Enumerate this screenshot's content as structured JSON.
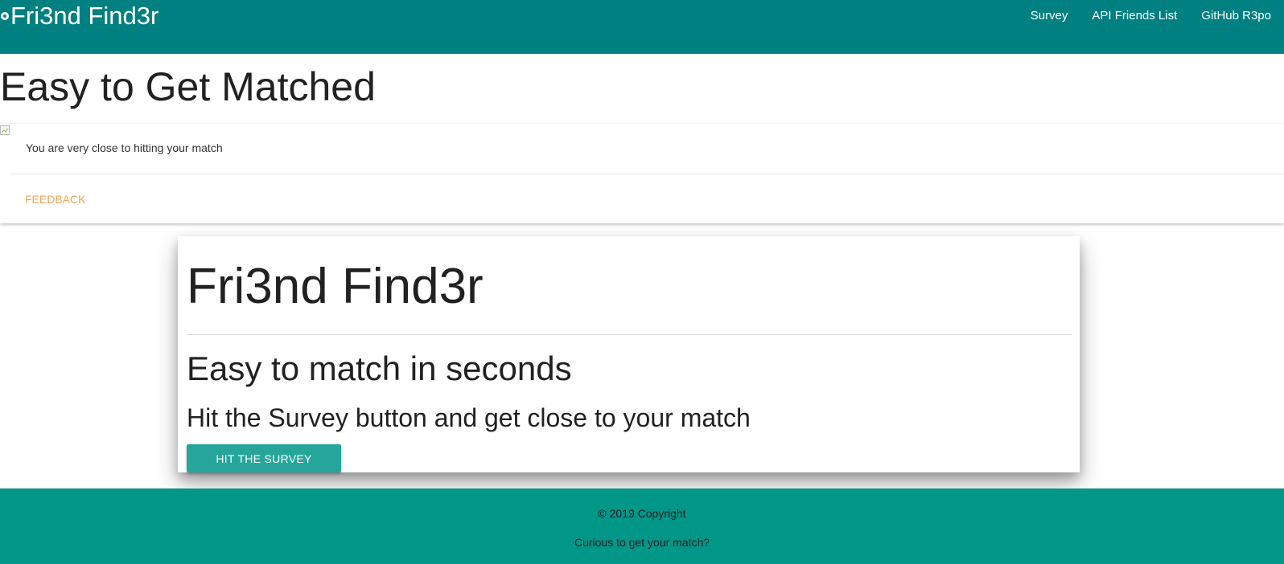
{
  "navbar": {
    "brand": "Fri3nd Find3r",
    "brand_icon": "logo-icon",
    "links": [
      "Survey",
      "API Friends List",
      "GitHub R3po"
    ]
  },
  "hero": {
    "title": "Easy to Get Matched"
  },
  "card": {
    "image_icon": "broken-image-icon",
    "text": "You are very close to hitting your match",
    "action": "FEEDBACK"
  },
  "jumbotron": {
    "title": "Fri3nd Find3r",
    "subtitle": "Easy to match in seconds",
    "lead": "Hit the Survey button and get close to your match",
    "button": "HIT THE SURVEY"
  },
  "footer": {
    "copyright": "© 2019 Copyright",
    "cta": "Curious to get your match?"
  },
  "colors": {
    "navbar": "#008080",
    "footer": "#009688",
    "button": "#26a69a",
    "link_accent": "#f2a65a"
  }
}
